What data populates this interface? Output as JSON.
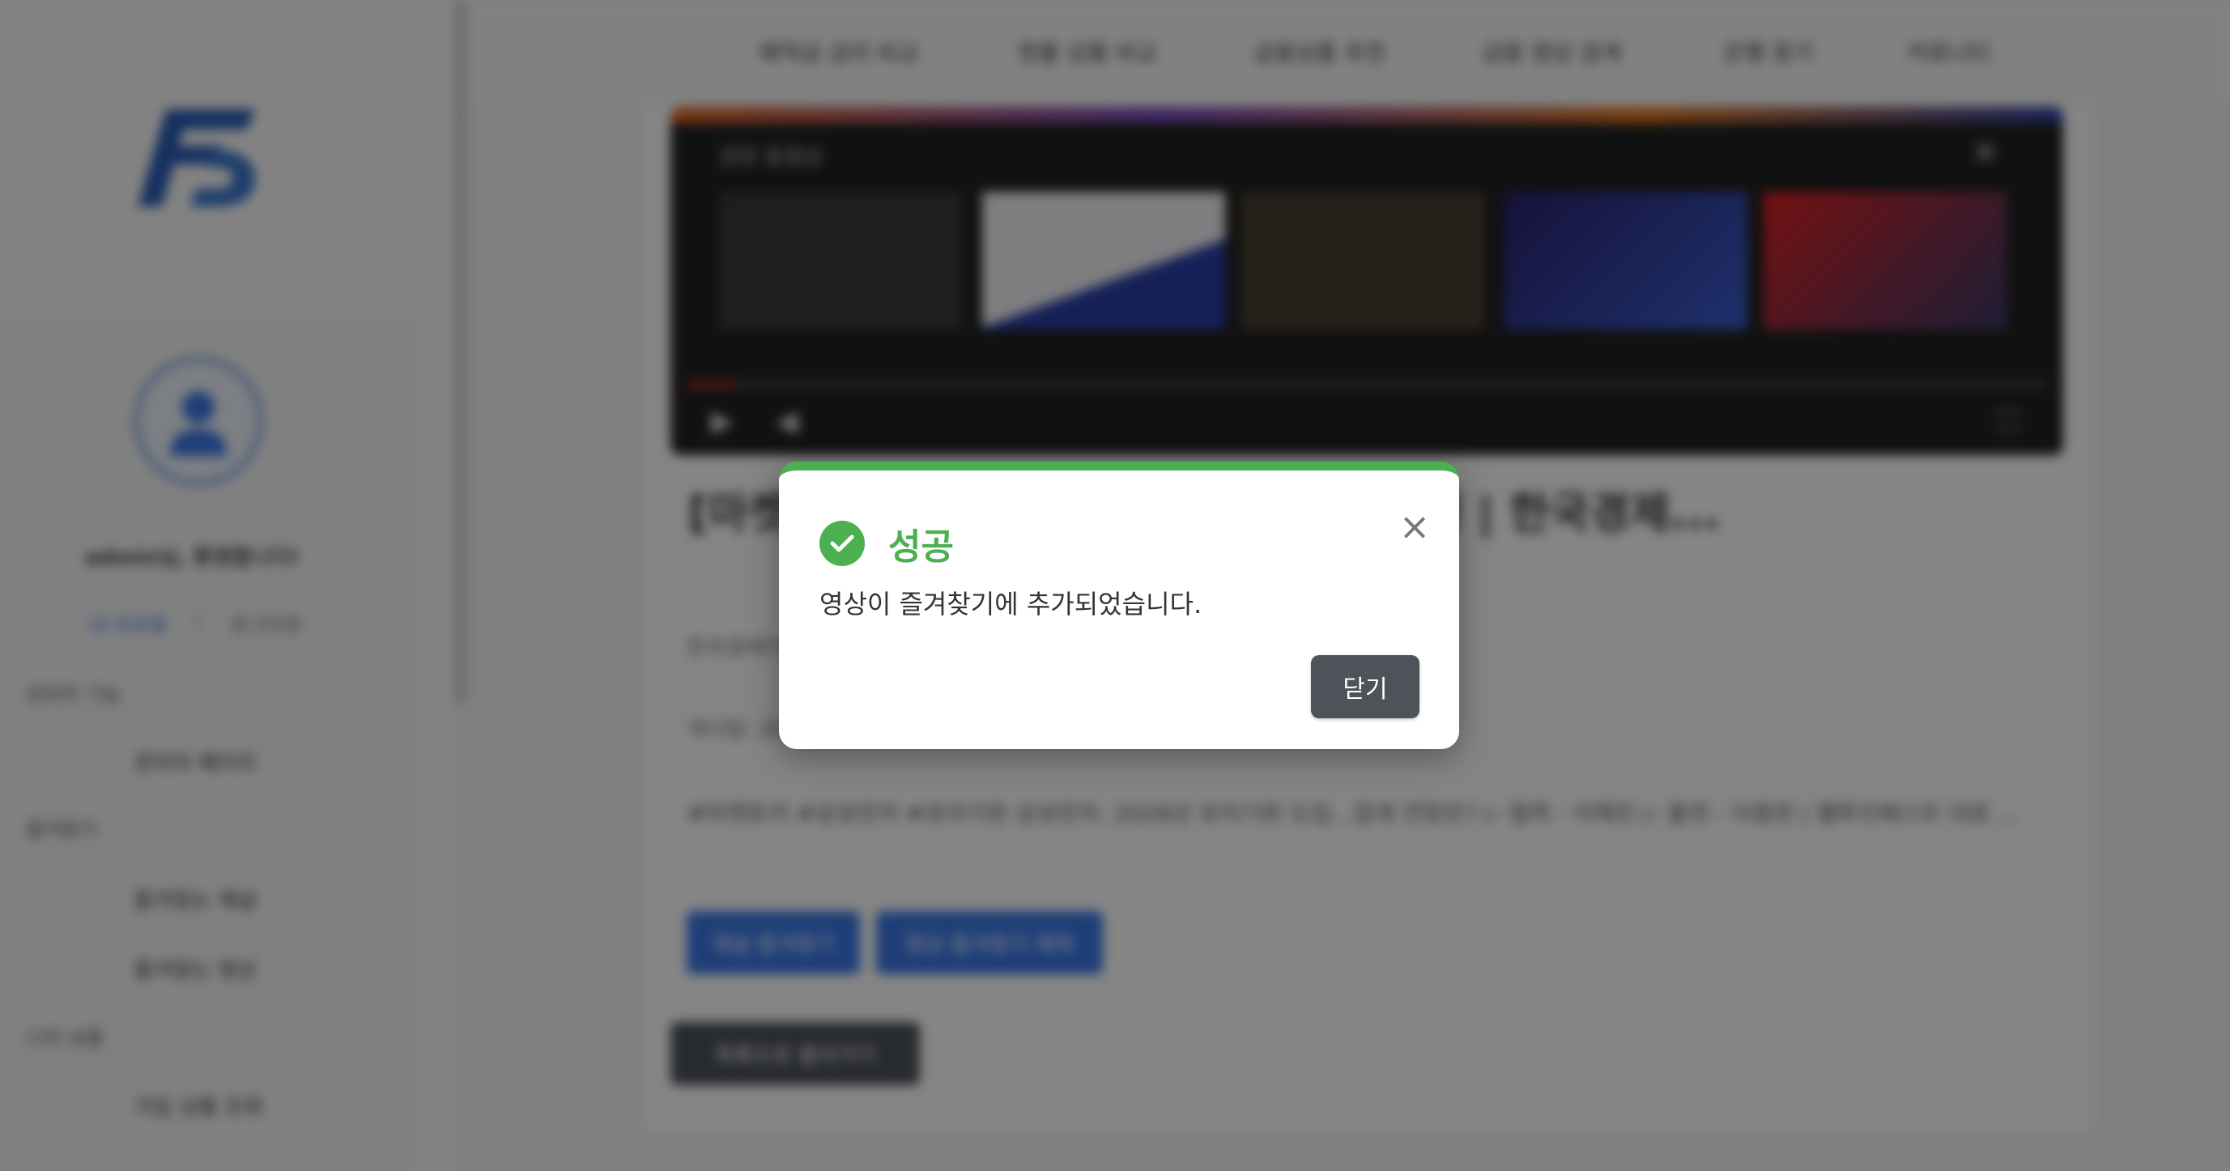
{
  "sidebar": {
    "user_name": "admin님, 환영합니다!",
    "links": [
      "내 프로필",
      "로그아웃"
    ],
    "sections": [
      {
        "title": "관리자 기능",
        "items": [
          "관리자 페이지"
        ]
      },
      {
        "title": "즐겨찾기",
        "items": [
          "즐겨찾는 채널",
          "즐겨찾는 영상"
        ]
      },
      {
        "title": "나의 상품",
        "items": [
          "가입 상품 조회"
        ]
      }
    ]
  },
  "nav": {
    "items": [
      "예적금 금리 비교",
      "현물 상품 비교",
      "금융상품 추천",
      "금융 영상 검색",
      "은행 찾기",
      "커뮤니티"
    ]
  },
  "video": {
    "overlay_title": "관련 동영상",
    "title": "[마켓...] ...도입...업계 전망은? | 이충헌 | 한국경제...",
    "channel": "한국경제TV",
    "date_label": "게시일: 20...",
    "description": "#마켓토커 #삼성전자 #유리기판 삼성전자, 2026년 유리기판 도입...업계 전망은? ▷ 협력 - 이해진 ▷ 출연 - 이충헌 | 웰투인베스트 대표 ...",
    "buttons": [
      "채널 즐겨찾기",
      "영상 즐겨찾기 해제"
    ],
    "back_button": "목록으로 돌아가기"
  },
  "modal": {
    "title": "성공",
    "message": "영상이 즐겨찾기에 추가되었습니다.",
    "close_icon": "×",
    "ok_label": "닫기",
    "accent_color": "#4caf50"
  },
  "colors": {
    "primary_button": "#3b78e7",
    "dark_button": "#4e5359"
  }
}
